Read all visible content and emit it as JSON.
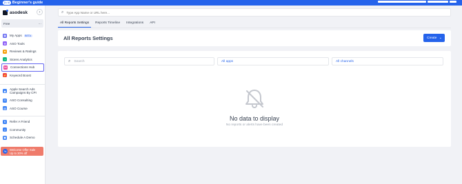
{
  "topbar": {
    "badge": "2 / 4",
    "guide_label": "Beginner's guide"
  },
  "brand": {
    "name": "asodesk"
  },
  "plan": {
    "label": "Free",
    "menu_glyph": "···"
  },
  "sidebar": {
    "group1": [
      {
        "label": "My Apps",
        "badge": "BETA",
        "icon": "apps-icon",
        "color": "#6366f1"
      },
      {
        "label": "ASO Tools",
        "icon": "tools-icon",
        "color": "#8b5cf6"
      },
      {
        "label": "Reviews & Ratings",
        "icon": "star-icon",
        "color": "#f59e0b"
      },
      {
        "label": "Stores Analytics",
        "icon": "analytics-icon",
        "color": "#10b981"
      },
      {
        "label": "Connections Hub",
        "icon": "hub-icon",
        "color": "#ec4899",
        "active": true
      },
      {
        "label": "Keyword Boost",
        "icon": "boost-icon",
        "color": "#ef4444"
      }
    ],
    "group2": [
      {
        "label": "Apple Search Ads Campaigns By CPI",
        "icon": "ads-icon",
        "color": "#3b82f6"
      },
      {
        "label": "ASO Consulting",
        "icon": "consulting-icon",
        "color": "#3b82f6"
      },
      {
        "label": "ASO Course",
        "icon": "course-icon",
        "color": "#3b82f6"
      }
    ],
    "group3": [
      {
        "label": "Refer A Friend",
        "icon": "refer-icon",
        "color": "#3b82f6"
      },
      {
        "label": "Community",
        "icon": "community-icon",
        "color": "#3b82f6"
      },
      {
        "label": "Schedule A Demo",
        "icon": "calendar-icon",
        "color": "#3b82f6"
      }
    ],
    "promo": {
      "icon_text": "%",
      "line1": "Welcome Offer Sale",
      "line2": "Up to 30% off"
    }
  },
  "search": {
    "placeholder": "Type App Name or URL here..."
  },
  "tabs": [
    {
      "label": "All Reports Settings",
      "active": true
    },
    {
      "label": "Reports Timeline",
      "active": false
    },
    {
      "label": "Integrations",
      "active": false
    },
    {
      "label": "API",
      "active": false
    }
  ],
  "header": {
    "title": "All Reports Settings",
    "create_label": "Create",
    "create_chevron": "⌄"
  },
  "filters": {
    "search_placeholder": "Search",
    "apps_value": "All apps",
    "channels_value": "All channels"
  },
  "empty": {
    "icon": "bell-off-icon",
    "title": "No data to display",
    "subtitle": "No reports or alerts have been created"
  },
  "colors": {
    "accent": "#2563eb",
    "promo": "#ef7b6b"
  }
}
